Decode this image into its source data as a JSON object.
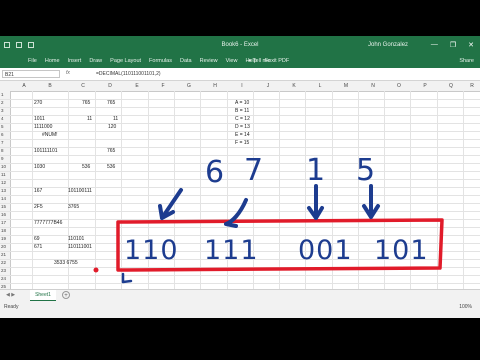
{
  "titlebar": {
    "title": "Book6 - Excel",
    "user": "John Gonzalez",
    "window_controls": [
      "—",
      "❐",
      "✕"
    ]
  },
  "ribbon": {
    "tabs": [
      "File",
      "Home",
      "Insert",
      "Draw",
      "Page Layout",
      "Formulas",
      "Data",
      "Review",
      "View",
      "Help",
      "Foxit PDF"
    ],
    "tell_me": "Tell me",
    "share": "Share"
  },
  "formula_bar": {
    "name_box": "B21",
    "fx": "fx",
    "formula": "=DECIMAL(110111001101,2)"
  },
  "columns": [
    "A",
    "B",
    "C",
    "D",
    "E",
    "F",
    "G",
    "H",
    "I",
    "J",
    "K",
    "L",
    "M",
    "N",
    "O",
    "P",
    "Q",
    "R"
  ],
  "rows": [
    "1",
    "2",
    "3",
    "4",
    "5",
    "6",
    "7",
    "8",
    "9",
    "10",
    "11",
    "12",
    "13",
    "14",
    "15",
    "16",
    "17",
    "18",
    "19",
    "20",
    "21",
    "22",
    "23",
    "24",
    "25",
    "26",
    "27",
    "28"
  ],
  "cells": {
    "b2": "270",
    "c2": "765",
    "d2": "765",
    "b4": "1011",
    "c4": "11",
    "d4": "11",
    "b5": "1111000",
    "d5": "120",
    "b6": "#NUM!",
    "b8": "101111101",
    "d8": "765",
    "b10": "1030",
    "c10": "536",
    "d10": "536",
    "b13": "167",
    "c13": "101100111",
    "b15": "2F5",
    "c15": "3765",
    "b17": "7777777B46",
    "b19": "69",
    "c19": "110101",
    "b20": "671",
    "c20": "110111001",
    "b22": "3533 6755",
    "j2": "A = 10",
    "j3": "B = 11",
    "j4": "C = 12",
    "j5": "D = 13",
    "j6": "E = 14",
    "j7": "F = 15"
  },
  "ink": {
    "top_digits": [
      "6",
      "7",
      "1",
      "5"
    ],
    "groups": [
      "110",
      "111",
      "001",
      "101"
    ],
    "color_red": "#e11b2a",
    "color_blue": "#1d3c8f"
  },
  "sheet_tabs": [
    "Sheet1"
  ],
  "status": {
    "ready": "Ready",
    "zoom": "100%"
  }
}
